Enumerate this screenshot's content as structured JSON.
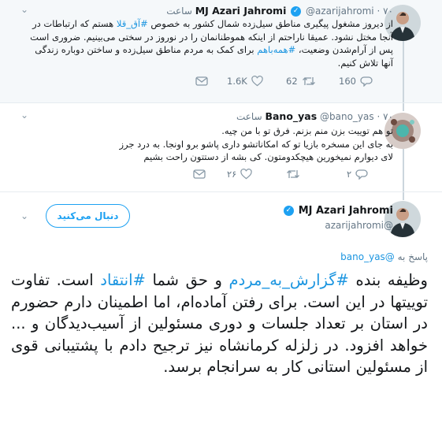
{
  "tweet1": {
    "name": "MJ Azari Jahromi",
    "handle": "@azarijahromi",
    "time": "۷۰ ساعت",
    "text_a": "از دیروز مشغول پیگیری مناطق سیل‌زده شمال کشور به خصوص ",
    "hashtag_1": "#آق_قلا",
    "text_b": " هستم که ارتباطات در آنجا مختل نشود. عمیقا ناراحتم از اینکه هموطنانمان را در نوروز در سختی می‌بینیم. ضروری است پس از آرام‌شدن وضعیت، ",
    "hashtag_2": "#همه‌باهم",
    "text_c": " برای کمک به مردم مناطق سیل‌زده و ساختن دوباره زندگی آنها تلاش کنیم.",
    "likes": "1.6K",
    "retweets": "62",
    "replies": "160"
  },
  "tweet2": {
    "name": "Bano_yas",
    "handle": "@bano_yas",
    "time": "۷۰ ساعت",
    "line1": "تو هم توییت بزن منم بزنم. فرق تو با من چیه.",
    "line2": "به جای این مسخره بازیا تو که امکاناتشو داری پاشو برو اونجا. به درد جرز لای دیوارم نمیخورین هیچکدومتون. کی بشه از دستتون راحت بشیم",
    "likes": "۲۶",
    "replies": "۲"
  },
  "tweet3": {
    "name": "MJ Azari Jahromi",
    "handle": "@azarijahromi",
    "follow_label": "دنبال می‌کنید",
    "reply_prefix": "پاسخ به ",
    "reply_handle": "@bano_yas",
    "text_a": "وظیفه بنده ",
    "hashtag_1": "#گزارش_به_مردم",
    "text_b": " و حق شما ",
    "hashtag_2": "#انتقاد",
    "text_c": " است. تفاوت توییتها در این است. برای رفتن آماده‌ام، اما اطمینان دارم حضورم در استان بر تعداد جلسات و دوری مسئولین از آسیب‌دیدگان و ... خواهد افزود. در زلزله کرمانشاه نیز ترجیح دادم با پشتیبانی قوی از مسئولین استانی کار به سرانجام برسد."
  },
  "colors": {
    "accent": "#1da1f2",
    "text": "#14171a",
    "muted": "#657786"
  },
  "icons": [
    "verified-icon",
    "caret-down-icon",
    "reply-icon",
    "retweet-icon",
    "like-icon",
    "dm-icon"
  ]
}
